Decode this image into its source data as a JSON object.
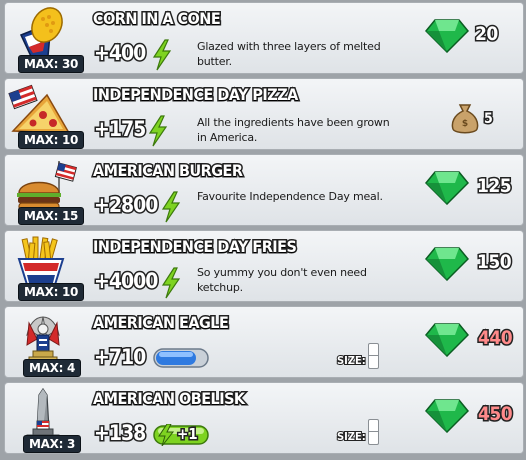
{
  "items": [
    {
      "title": "CORN IN A CONE",
      "max": "MAX: 30",
      "bonus": "+400",
      "desc": "Glazed with three layers of melted butter.",
      "price": "20",
      "currency": "gem-icon",
      "thumb": "corn-cone-icon"
    },
    {
      "title": "INDEPENDENCE DAY PIZZA",
      "max": "MAX: 10",
      "bonus": "+175",
      "desc": "All the ingredients have been grown in America.",
      "price": "5",
      "currency": "coin-bag-icon",
      "thumb": "pizza-icon"
    },
    {
      "title": "AMERICAN BURGER",
      "max": "MAX: 15",
      "bonus": "+2800",
      "desc": "Favourite Independence Day meal.",
      "price": "125",
      "currency": "gem-icon",
      "thumb": "burger-icon"
    },
    {
      "title": "INDEPENDENCE DAY FRIES",
      "max": "MAX: 10",
      "bonus": "+4000",
      "desc": "So yummy you don't even need ketchup.",
      "price": "150",
      "currency": "gem-icon",
      "thumb": "fries-icon"
    },
    {
      "title": "AMERICAN EAGLE",
      "max": "MAX: 4",
      "bonus": "+710",
      "size_label": "SIZE:",
      "price": "440",
      "price_unaffordable": true,
      "currency": "gem-icon",
      "thumb": "eagle-statue-icon"
    },
    {
      "title": "AMERICAN OBELISK",
      "max": "MAX: 3",
      "bonus": "+138",
      "boost": "+1",
      "size_label": "SIZE:",
      "price": "450",
      "price_unaffordable": true,
      "currency": "gem-icon",
      "thumb": "obelisk-icon"
    }
  ],
  "colors": {
    "gem": "#1fb84a",
    "affordable_price": "#ffffff",
    "unaffordable_price": "#ff8a8a",
    "energy": "#7ed321"
  }
}
